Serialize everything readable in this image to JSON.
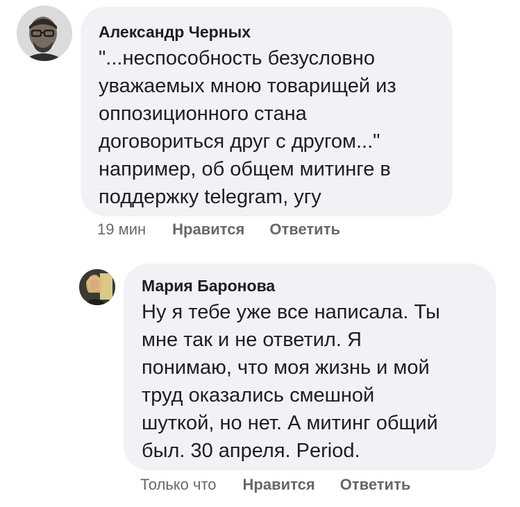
{
  "comments": [
    {
      "author": "Александр Черных",
      "text": "\"...неспособность безусловно\nуважаемых мною товарищей из\nоппозиционного стана\nдоговориться друг с другом...\"\nнапример, об общем митинге в\nподдержку telegram, угу",
      "time": "19 мин",
      "like_label": "Нравится",
      "reply_label": "Ответить"
    },
    {
      "author": "Мария Баронова",
      "text": "Ну я тебе уже все написала. Ты\nмне так и не ответил. Я\nпонимаю, что моя жизнь и мой\nтруд оказались смешной\nшуткой, но нет. А митинг общий\nбыл. 30 апреля. Period.",
      "time": "Только что",
      "like_label": "Нравится",
      "reply_label": "Ответить"
    }
  ],
  "colors": {
    "bubble": "#f0f2f5",
    "text": "#1c1e21",
    "secondary": "#65676b"
  }
}
